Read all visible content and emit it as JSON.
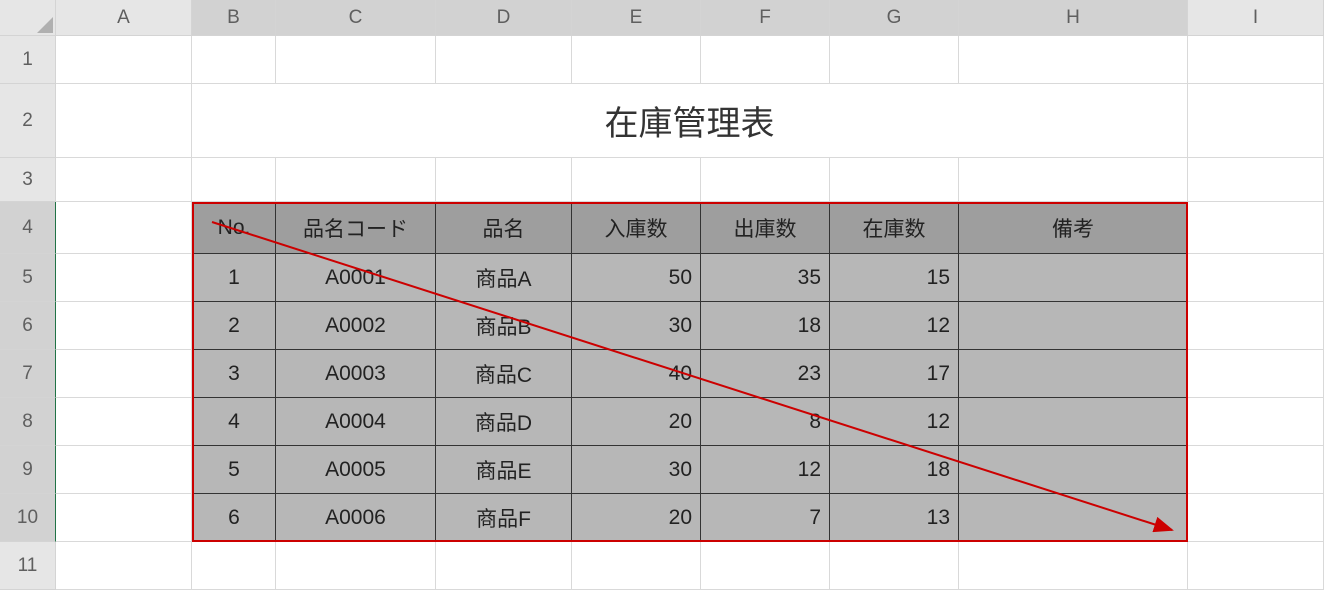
{
  "columns": [
    "A",
    "B",
    "C",
    "D",
    "E",
    "F",
    "G",
    "H",
    "I"
  ],
  "rows": [
    "1",
    "2",
    "3",
    "4",
    "5",
    "6",
    "7",
    "8",
    "9",
    "10",
    "11"
  ],
  "title": "在庫管理表",
  "headers": {
    "no": "No.",
    "code": "品名コード",
    "name": "品名",
    "in": "入庫数",
    "out": "出庫数",
    "stock": "在庫数",
    "remarks": "備考"
  },
  "data": [
    {
      "no": "1",
      "code": "A0001",
      "name": "商品A",
      "in": "50",
      "out": "35",
      "stock": "15",
      "remarks": ""
    },
    {
      "no": "2",
      "code": "A0002",
      "name": "商品B",
      "in": "30",
      "out": "18",
      "stock": "12",
      "remarks": ""
    },
    {
      "no": "3",
      "code": "A0003",
      "name": "商品C",
      "in": "40",
      "out": "23",
      "stock": "17",
      "remarks": ""
    },
    {
      "no": "4",
      "code": "A0004",
      "name": "商品D",
      "in": "20",
      "out": "8",
      "stock": "12",
      "remarks": ""
    },
    {
      "no": "5",
      "code": "A0005",
      "name": "商品E",
      "in": "30",
      "out": "12",
      "stock": "18",
      "remarks": ""
    },
    {
      "no": "6",
      "code": "A0006",
      "name": "商品F",
      "in": "20",
      "out": "7",
      "stock": "13",
      "remarks": ""
    }
  ]
}
